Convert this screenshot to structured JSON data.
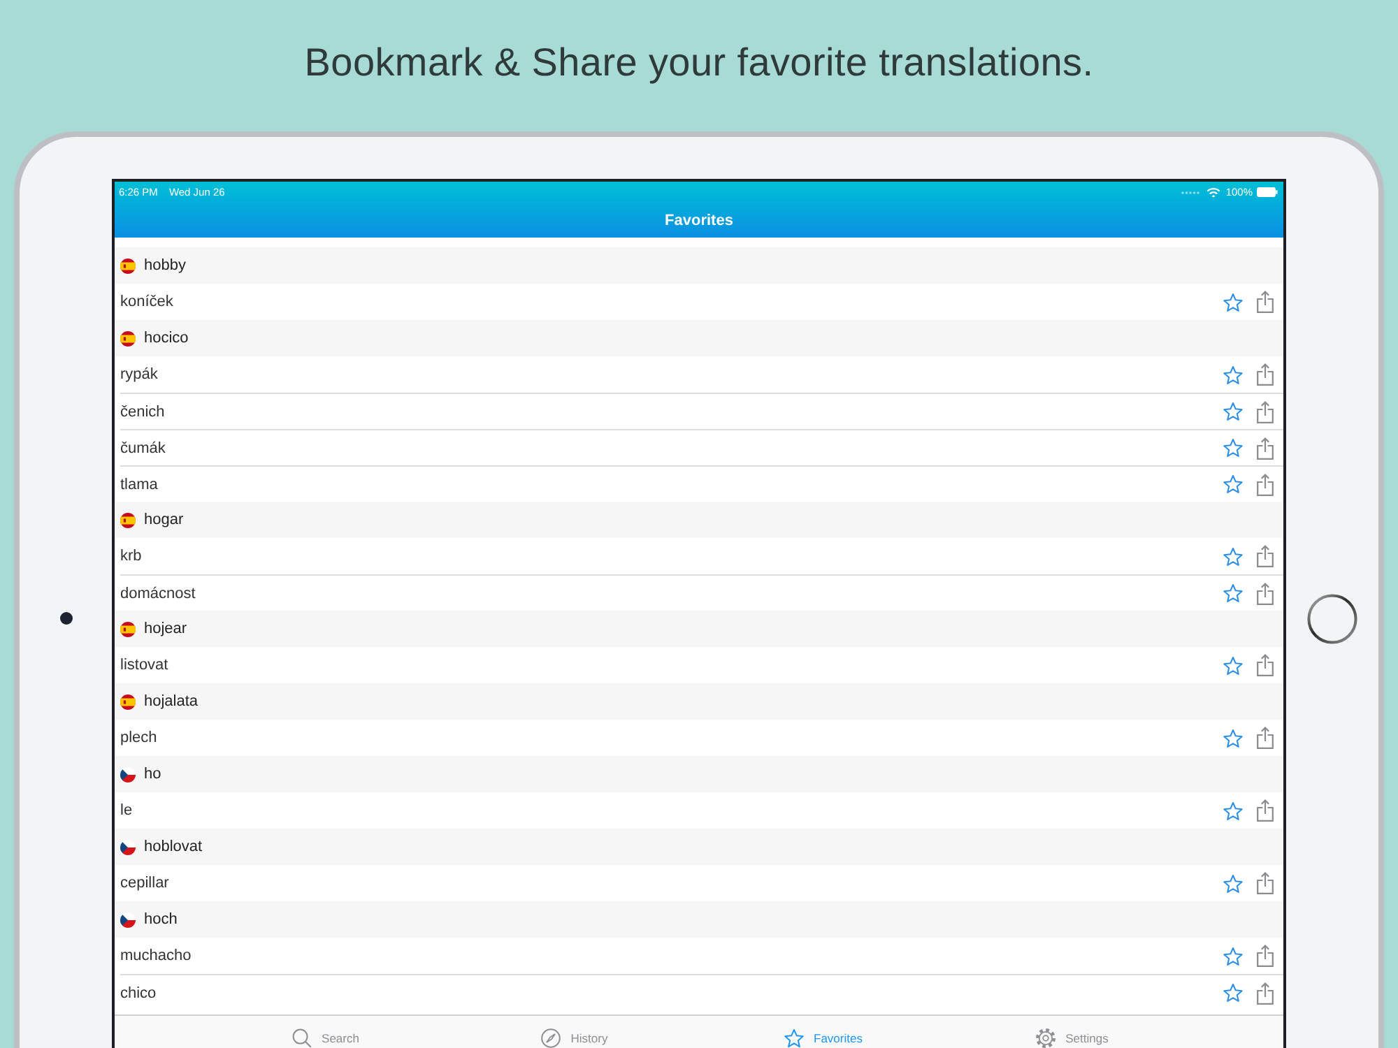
{
  "headline": "Bookmark & Share your favorite translations.",
  "status_bar": {
    "time": "6:26 PM",
    "date": "Wed Jun 26",
    "battery": "100%"
  },
  "nav_bar": {
    "title": "Favorites"
  },
  "favorites": [
    {
      "word": "hobby",
      "kind": "spanish",
      "translations": [
        "koníček"
      ]
    },
    {
      "word": "hocico",
      "kind": "spanish",
      "translations": [
        "rypák",
        "čenich",
        "čumák",
        "tlama"
      ]
    },
    {
      "word": "hogar",
      "kind": "spanish",
      "translations": [
        "krb",
        "domácnost"
      ]
    },
    {
      "word": "hojear",
      "kind": "spanish",
      "translations": [
        "listovat"
      ]
    },
    {
      "word": "hojalata",
      "kind": "spanish",
      "translations": [
        "plech"
      ]
    },
    {
      "word": "ho",
      "kind": "czech",
      "translations": [
        "le"
      ]
    },
    {
      "word": "hoblovat",
      "kind": "czech",
      "translations": [
        "cepillar"
      ]
    },
    {
      "word": "hoch",
      "kind": "czech",
      "translations": [
        "muchacho",
        "chico"
      ]
    }
  ],
  "tab_bar": [
    {
      "label": "Search",
      "selected": false
    },
    {
      "label": "History",
      "selected": false
    },
    {
      "label": "Favorites",
      "selected": true
    },
    {
      "label": "Settings",
      "selected": false
    }
  ]
}
